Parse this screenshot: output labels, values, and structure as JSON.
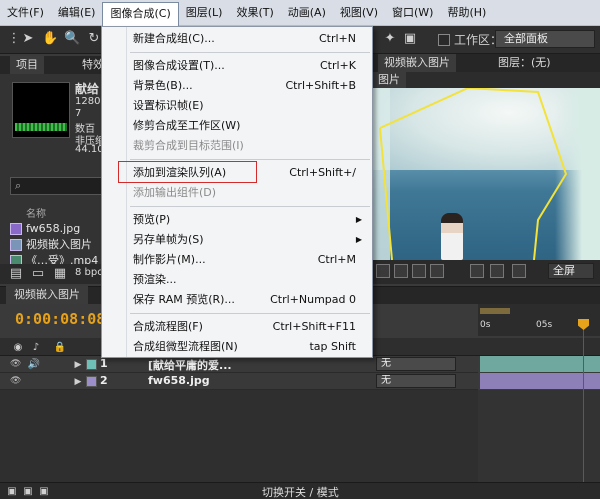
{
  "menubar": {
    "items": [
      {
        "label": "文件(F)"
      },
      {
        "label": "编辑(E)"
      },
      {
        "label": "图像合成(C)"
      },
      {
        "label": "图层(L)"
      },
      {
        "label": "效果(T)"
      },
      {
        "label": "动画(A)"
      },
      {
        "label": "视图(V)"
      },
      {
        "label": "窗口(W)"
      },
      {
        "label": "帮助(H)"
      }
    ]
  },
  "toolbar": {
    "workspace_label": "工作区：",
    "workspace_value": "全部面板"
  },
  "project_panel": {
    "tab_project": "项目",
    "tab_effects": "特效",
    "item_name": "献给",
    "item_info": [
      "1280",
      "7",
      "数百",
      "非压缩",
      "44.10"
    ],
    "search_placeholder": "",
    "name_col": "名称",
    "items": [
      {
        "name": "fw658.jpg"
      },
      {
        "name": "视频嵌入图片"
      },
      {
        "name": "《…受》.mp4"
      }
    ],
    "bpc": "8 bpc"
  },
  "viewer": {
    "tab_comp": "视频嵌入图片",
    "tab_layer": "图层：(无)",
    "subtab": "图片"
  },
  "viewer_footer": {
    "full_label": "全屏"
  },
  "timeline": {
    "tab_label": "视频嵌入图片",
    "timecode": "0:00:08:08",
    "ruler_labels": [
      "0s",
      "05s"
    ],
    "layers": [
      {
        "num": "1",
        "name": "[献给平庸的爱...",
        "mode": "无"
      },
      {
        "num": "2",
        "name": "fw658.jpg",
        "mode": "无"
      }
    ],
    "switch_mode_label": "切换开关 / 模式"
  },
  "dropdown": {
    "items": [
      {
        "label": "新建合成组(C)...",
        "shortcut": "Ctrl+N"
      },
      {
        "label": "图像合成设置(T)...",
        "shortcut": "Ctrl+K"
      },
      {
        "label": "背景色(B)...",
        "shortcut": "Ctrl+Shift+B"
      },
      {
        "label": "设置标识帧(E)",
        "shortcut": ""
      },
      {
        "label": "修剪合成至工作区(W)",
        "shortcut": ""
      },
      {
        "label": "裁剪合成到目标范围(I)",
        "shortcut": ""
      },
      {
        "label": "添加到渲染队列(A)",
        "shortcut": "Ctrl+Shift+/"
      },
      {
        "label": "添加输出组件(D)",
        "shortcut": ""
      },
      {
        "label": "预览(P)",
        "shortcut": ""
      },
      {
        "label": "另存单帧为(S)",
        "shortcut": ""
      },
      {
        "label": "制作影片(M)...",
        "shortcut": "Ctrl+M"
      },
      {
        "label": "预渲染...",
        "shortcut": ""
      },
      {
        "label": "保存 RAM 预览(R)...",
        "shortcut": "Ctrl+Numpad 0"
      },
      {
        "label": "合成流程图(F)",
        "shortcut": "Ctrl+Shift+F11"
      },
      {
        "label": "合成组微型流程图(N)",
        "shortcut": "tap Shift"
      }
    ]
  },
  "colors": {
    "timecode": "#e7a21b",
    "highlight": "#d42a2a",
    "mask_path": "#f2e23a"
  }
}
